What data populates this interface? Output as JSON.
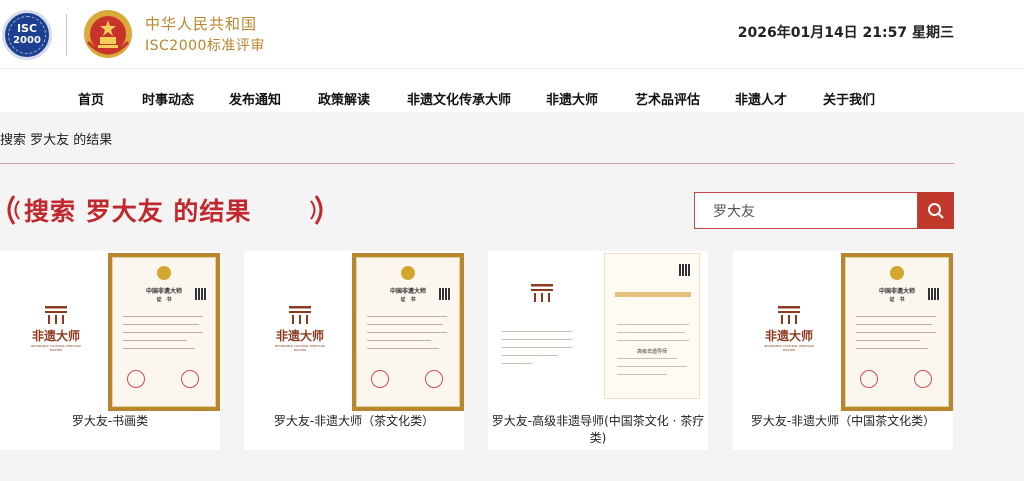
{
  "header": {
    "logo_text_top": "ISC",
    "logo_text_bottom": "2000",
    "org_name": "中华人民共和国",
    "org_sub": "ISC2000标准评审",
    "datetime": "2026年01月14日 21:57 星期三"
  },
  "nav": [
    {
      "label": "首页"
    },
    {
      "label": "时事动态"
    },
    {
      "label": "发布通知"
    },
    {
      "label": "政策解读"
    },
    {
      "label": "非遗文化传承大师"
    },
    {
      "label": "非遗大师"
    },
    {
      "label": "艺术品评估"
    },
    {
      "label": "非遗人才"
    },
    {
      "label": "关于我们"
    }
  ],
  "breadcrumb": "搜索 罗大友 的结果",
  "page_title": "搜索 罗大友 的结果",
  "search": {
    "value": "罗大友"
  },
  "brand": {
    "name": "非遗大师",
    "en": "INTANGIBLE CULTURAL HERITAGE MASTER"
  },
  "certificate": {
    "title": "中国非遗大师",
    "subtitle": "证　书",
    "white_title": "高级非遗导师"
  },
  "results": [
    {
      "label": "罗大友-书画类"
    },
    {
      "label": "罗大友-非遗大师（茶文化类）"
    },
    {
      "label": "罗大友-高级非遗导师(中国茶文化 · 茶疗类)"
    },
    {
      "label": "罗大友-非遗大师（中国茶文化类）"
    }
  ],
  "colors": {
    "accent_red": "#c0282d",
    "gold": "#b8862c",
    "brand_brown": "#8c3a1f"
  }
}
